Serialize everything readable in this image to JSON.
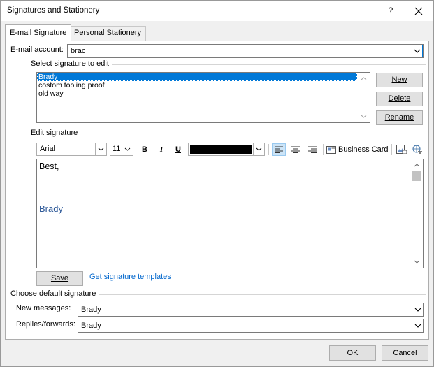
{
  "window": {
    "title": "Signatures and Stationery",
    "help_label": "?"
  },
  "tabs": [
    {
      "label": "E-mail Signature",
      "active": true
    },
    {
      "label": "Personal Stationery",
      "active": false
    }
  ],
  "email_account": {
    "label": "E-mail account:",
    "value": "brac"
  },
  "select_signature": {
    "legend": "Select signature to edit",
    "items": [
      "Brady",
      "costom tooling proof",
      "old way"
    ],
    "selected_index": 0
  },
  "actions": {
    "new_label": "New",
    "delete_label": "Delete",
    "rename_label": "Rename"
  },
  "edit_signature": {
    "legend": "Edit signature",
    "font_name": "Arial",
    "font_size": "11",
    "font_color": "#000000",
    "bold_label": "B",
    "italic_label": "I",
    "underline_label": "U",
    "business_card_label": "Business Card",
    "active_alignment": "left",
    "body_line1": "Best,",
    "body_link": "Brady"
  },
  "save_label": "Save",
  "templates_link": "Get signature templates",
  "default_signature": {
    "legend": "Choose default signature",
    "new_messages_label": "New messages:",
    "new_messages_value": "Brady",
    "replies_label": "Replies/forwards:",
    "replies_value": "Brady"
  },
  "footer": {
    "ok_label": "OK",
    "cancel_label": "Cancel"
  },
  "colors": {
    "selection": "#0078d7",
    "link": "#2b5797",
    "focus_border": "#0078d7"
  }
}
